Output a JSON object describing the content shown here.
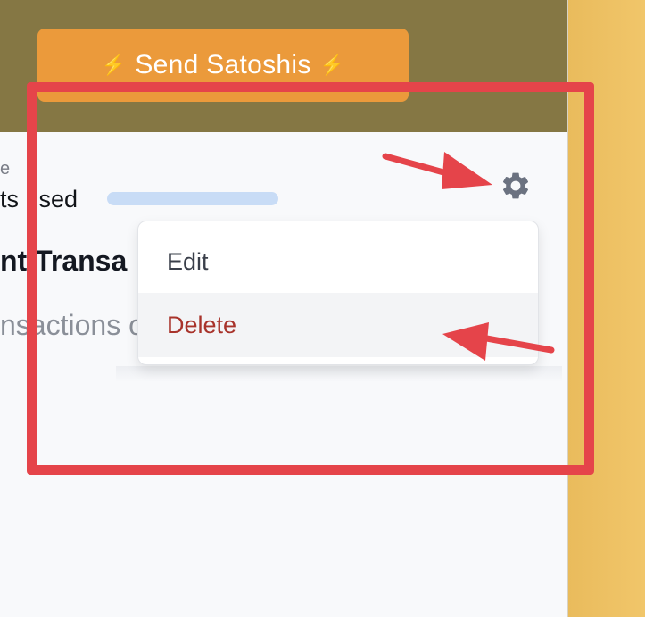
{
  "header": {
    "send_button": {
      "label": "Send Satoshis",
      "icon_left": "⚡",
      "icon_right": "⚡"
    }
  },
  "content": {
    "small_label": "e",
    "used_label": "ts used",
    "heading": "nt Transa",
    "subtext": "nsactions o"
  },
  "settings": {
    "icon": "gear-icon"
  },
  "menu": {
    "items": [
      {
        "label": "Edit"
      },
      {
        "label": "Delete"
      }
    ]
  },
  "colors": {
    "header_bg": "#857744",
    "send_button_bg": "#eb9a3b",
    "delete_text": "#a8332b",
    "annotation_red": "#e5444a",
    "right_strip": "#efc468"
  }
}
